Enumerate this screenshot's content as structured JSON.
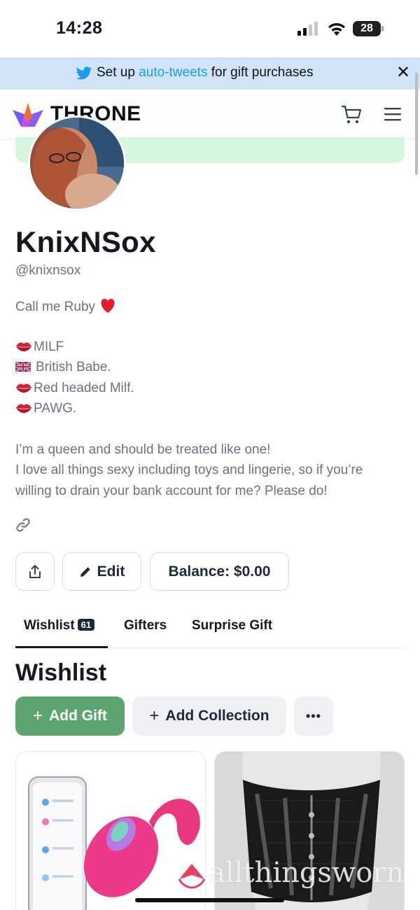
{
  "status_bar": {
    "time": "14:28",
    "battery": "28"
  },
  "banner": {
    "text_before": "Set up ",
    "link_text": "auto-tweets",
    "text_after": " for gift purchases",
    "close_label": "✕"
  },
  "header": {
    "logo_text": "THRONE"
  },
  "profile": {
    "name": "KnixNSox",
    "handle": "@knixnsox",
    "bio": {
      "line1": "Call me Ruby",
      "line2": "MILF",
      "line3": "British Babe.",
      "line4": "Red headed Milf.",
      "line5": "PAWG.",
      "line6": "I’m a queen and should be treated like one!",
      "line7": "I love all things sexy including toys and lingerie, so if you’re",
      "line8": "willing to drain your bank account for me? Please do!"
    }
  },
  "actions": {
    "edit_label": "Edit",
    "balance_label": "Balance: $0.00"
  },
  "tabs": [
    {
      "label": "Wishlist",
      "count": "61"
    },
    {
      "label": "Gifters"
    },
    {
      "label": "Surprise Gift"
    }
  ],
  "wishlist": {
    "title": "Wishlist",
    "add_gift_label": "Add Gift",
    "add_collection_label": "Add Collection",
    "more_label": "•••"
  },
  "watermark": "allthingsworn",
  "colors": {
    "brand_green": "#5da46f",
    "banner_bg": "#cfe4f6",
    "link_blue": "#1d9bf0",
    "cover_green": "#d6f6de"
  }
}
